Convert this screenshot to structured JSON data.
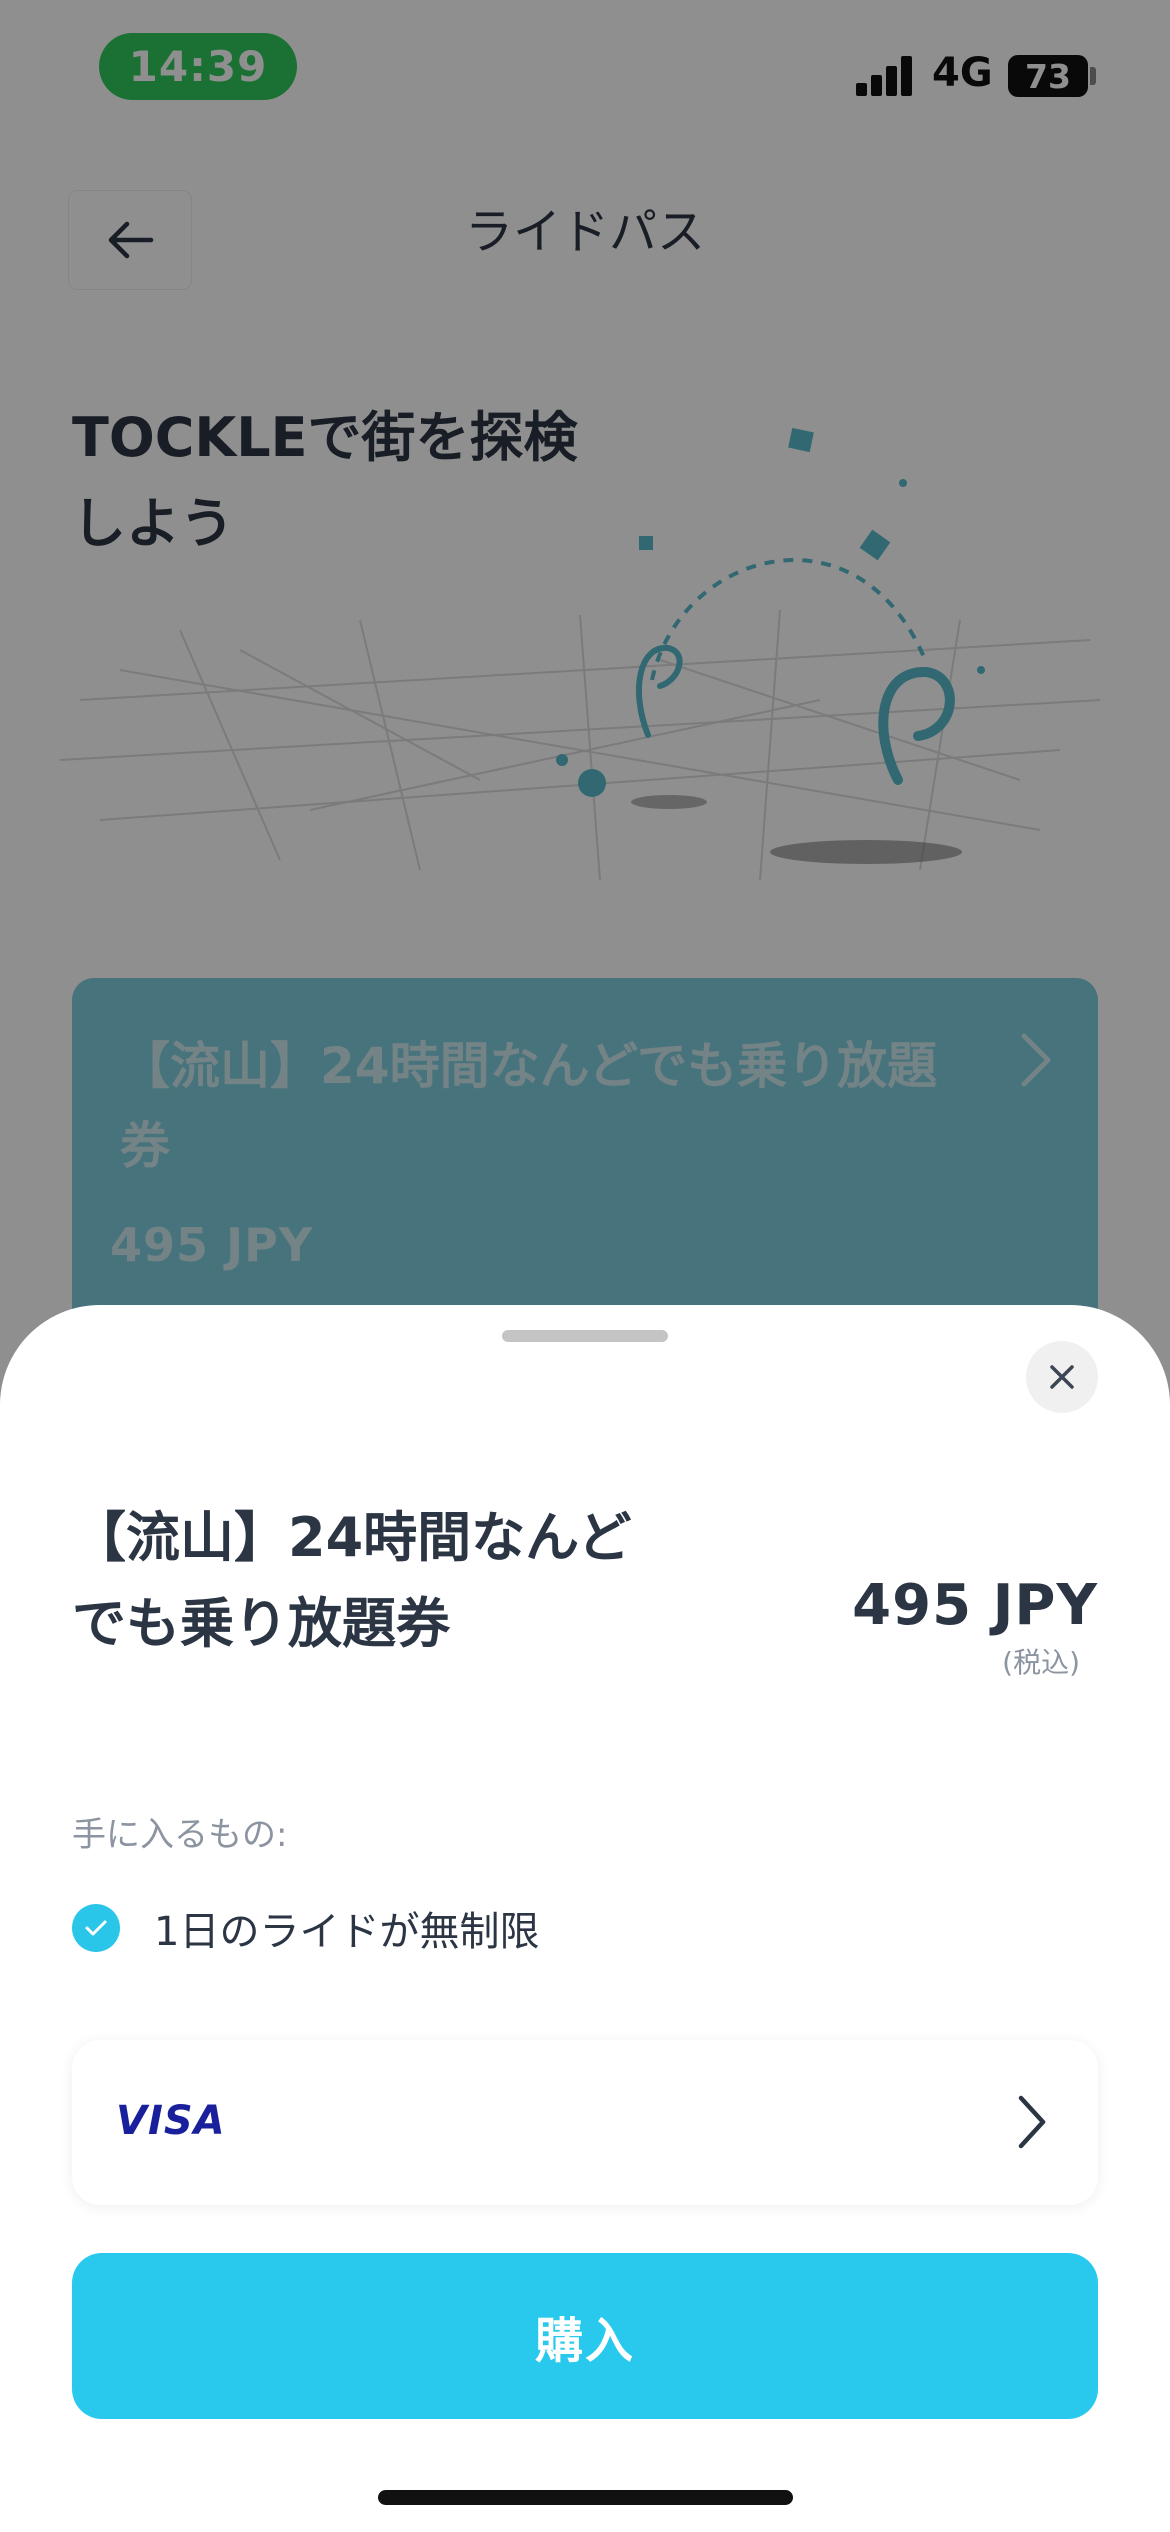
{
  "status_bar": {
    "time": "14:39",
    "network": "4G",
    "battery": "73",
    "time_pill_color": "#2fc95b"
  },
  "header": {
    "title": "ライドパス",
    "back_icon": "arrow-left-icon"
  },
  "hero": {
    "heading": "TOCKLEで街を探検しよう",
    "illustration": "scooter-jump-illustration"
  },
  "pass_card": {
    "title": "【流山】24時間なんどでも乗り放題券",
    "price": "495 JPY",
    "color": "#7fcedd"
  },
  "sheet": {
    "close_icon": "close-icon",
    "title": "【流山】24時間なんどでも乗り放題券",
    "price": "495 JPY",
    "tax_note": "(税込)",
    "includes_label": "手に入るもの:",
    "features": [
      {
        "icon": "check-icon",
        "text": "1日のライドが無制限"
      }
    ],
    "payment": {
      "brand": "VISA",
      "chevron_icon": "chevron-right-icon"
    },
    "purchase_label": "購入",
    "accent_color": "#29c9ed"
  }
}
